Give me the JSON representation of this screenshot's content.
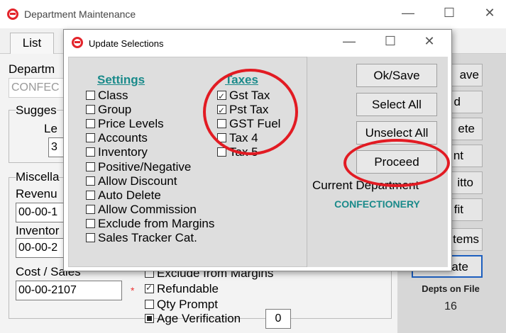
{
  "background_window": {
    "title": "Department Maintenance",
    "controls": {
      "minimize": "—",
      "maximize": "☐",
      "close": "✕"
    },
    "tab": "List",
    "department_label": "Departm",
    "department_value": "CONFEC",
    "suggest_label": "Sugges",
    "level_label": "Le",
    "level_value": "3",
    "misc_label": "Miscella",
    "revenue_label": "Revenu",
    "revenue_value": "00-00-1",
    "inventory_label": "Inventor",
    "inventory_value": "00-00-2",
    "cost_label": "Cost / Sales",
    "cost_value": "00-00-2107",
    "required_mark": "*",
    "options": [
      {
        "label": "Exclude from Margins",
        "state": "unchecked"
      },
      {
        "label": "Refundable",
        "state": "checked"
      },
      {
        "label": "Qty Prompt",
        "state": "unchecked"
      },
      {
        "label": "Age Verification",
        "state": "filled"
      }
    ],
    "age_value": "0",
    "side_buttons": [
      "ave",
      "d",
      "ete",
      "nt",
      "itto",
      "fit",
      "tems",
      "ate"
    ],
    "depts_on_file_label": "Depts on File",
    "depts_on_file_value": "16"
  },
  "dialog": {
    "title": "Update Selections",
    "controls": {
      "minimize": "—",
      "maximize": "☐",
      "close": "✕"
    },
    "settings_header": "Settings",
    "settings": [
      {
        "label": "Class",
        "checked": false
      },
      {
        "label": "Group",
        "checked": false
      },
      {
        "label": "Price Levels",
        "checked": false
      },
      {
        "label": "Accounts",
        "checked": false
      },
      {
        "label": "Inventory",
        "checked": false
      },
      {
        "label": "Positive/Negative",
        "checked": false
      },
      {
        "label": "Allow Discount",
        "checked": false
      },
      {
        "label": "Auto Delete",
        "checked": false
      },
      {
        "label": "Allow Commission",
        "checked": false
      },
      {
        "label": "Exclude from Margins",
        "checked": false
      },
      {
        "label": "Sales Tracker Cat.",
        "checked": false
      }
    ],
    "taxes_header": "Taxes",
    "taxes": [
      {
        "label": "Gst Tax",
        "checked": true
      },
      {
        "label": "Pst Tax",
        "checked": true
      },
      {
        "label": "GST Fuel",
        "checked": false
      },
      {
        "label": "Tax 4",
        "checked": false
      },
      {
        "label": "Tax 5",
        "checked": false
      }
    ],
    "buttons": {
      "ok": "Ok/Save",
      "select_all": "Select All",
      "unselect_all": "Unselect All",
      "proceed": "Proceed"
    },
    "current_department_label": "Current Department",
    "current_department_value": "CONFECTIONERY"
  },
  "annotation_color": "#e21b23",
  "accent_color": "#1a8a8a"
}
